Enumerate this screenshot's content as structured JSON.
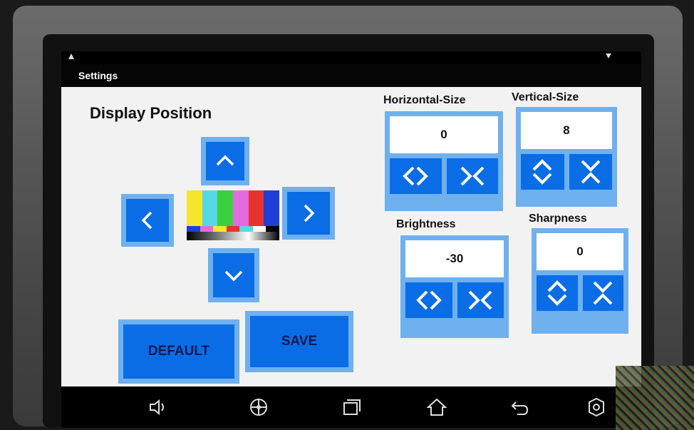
{
  "app": {
    "title": "Settings"
  },
  "display_position": {
    "heading": "Display Position",
    "colorbar_colors": [
      "#f7e62c",
      "#58d7e6",
      "#3bd13e",
      "#e36be0",
      "#e8332d",
      "#1f3fd6"
    ],
    "colorbar_mini_colors": [
      "#1f3fd6",
      "#e36be0",
      "#f7e62c",
      "#e8332d",
      "#58d7e6",
      "#ffffff",
      "#000000"
    ]
  },
  "buttons": {
    "default_label": "DEFAULT",
    "save_label": "SAVE"
  },
  "settings": {
    "horizontal_size": {
      "label": "Horizontal-Size",
      "value": "0"
    },
    "vertical_size": {
      "label": "Vertical-Size",
      "value": "8"
    },
    "brightness": {
      "label": "Brightness",
      "value": "-30"
    },
    "sharpness": {
      "label": "Sharpness",
      "value": "0"
    }
  },
  "colors": {
    "button_blue": "#0a6de6",
    "button_border": "#6fb0ee",
    "background": "#f2f2f2"
  },
  "nav_icons": [
    "volume-icon",
    "steering-wheel-icon",
    "recent-apps-icon",
    "home-icon",
    "back-icon",
    "settings-icon"
  ]
}
